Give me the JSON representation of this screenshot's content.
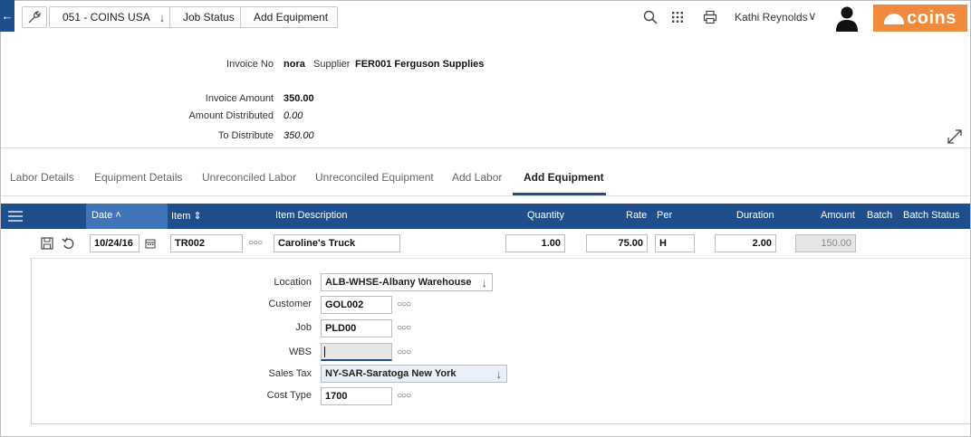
{
  "topbar": {
    "company": "051 - COINS USA",
    "crumbs": [
      "Job Status",
      "Add Equipment"
    ],
    "user": "Kathi Reynolds",
    "logo_text": "coins",
    "accent": "#1f4e8c",
    "logo_color": "#f08a3c"
  },
  "invoice": {
    "invoice_no_label": "Invoice No",
    "invoice_no": "nora",
    "supplier_label": "Supplier",
    "supplier": "FER001 Ferguson Supplies",
    "invoice_amount_label": "Invoice Amount",
    "invoice_amount": "350.00",
    "amount_distributed_label": "Amount Distributed",
    "amount_distributed": "0.00",
    "to_distribute_label": "To Distribute",
    "to_distribute": "350.00"
  },
  "tabs": [
    "Labor Details",
    "Equipment Details",
    "Unreconciled Labor",
    "Unreconciled Equipment",
    "Add Labor",
    "Add Equipment"
  ],
  "grid": {
    "columns": {
      "date": "Date",
      "item": "Item",
      "item_description": "Item Description",
      "quantity": "Quantity",
      "rate": "Rate",
      "per": "Per",
      "duration": "Duration",
      "amount": "Amount",
      "batch": "Batch",
      "batch_status": "Batch Status"
    },
    "row": {
      "date": "10/24/16",
      "item": "TR002",
      "item_description": "Caroline's Truck",
      "quantity": "1.00",
      "rate": "75.00",
      "per": "H",
      "duration": "2.00",
      "amount": "150.00"
    }
  },
  "detail": {
    "location_label": "Location",
    "location": "ALB-WHSE-Albany Warehouse",
    "customer_label": "Customer",
    "customer": "GOL002",
    "job_label": "Job",
    "job": "PLD00",
    "wbs_label": "WBS",
    "wbs": "",
    "sales_tax_label": "Sales Tax",
    "sales_tax": "NY-SAR-Saratoga New York",
    "cost_type_label": "Cost Type",
    "cost_type": "1700"
  },
  "icons": [
    "back-arrow-icon",
    "wrench-icon",
    "chevron-down-icon",
    "search-icon",
    "grid-menu-icon",
    "print-icon",
    "avatar-icon",
    "expand-icon",
    "hamburger-icon",
    "sort-asc-icon",
    "sort-icon",
    "save-icon",
    "undo-icon",
    "calendar-icon",
    "more-dots-icon"
  ]
}
